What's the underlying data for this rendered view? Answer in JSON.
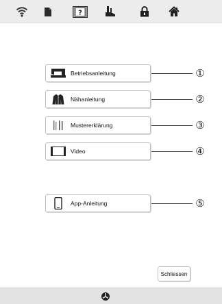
{
  "topbar": {
    "icons": [
      "wifi-icon",
      "page-icon",
      "help-icon",
      "presser-foot-icon",
      "lock-icon",
      "home-icon"
    ]
  },
  "menu": {
    "items": [
      {
        "label": "Betriebsanleitung",
        "icon": "sewing-machine-icon",
        "callout": "①"
      },
      {
        "label": "Nähanleitung",
        "icon": "garment-icon",
        "callout": "②"
      },
      {
        "label": "Mustererklärung",
        "icon": "stitch-pattern-icon",
        "callout": "③"
      },
      {
        "label": "Video",
        "icon": "video-icon",
        "callout": "④"
      },
      {
        "label": "App-Anleitung",
        "icon": "smartphone-icon",
        "callout": "⑤"
      }
    ]
  },
  "footer": {
    "close_label": "Schliessen",
    "bottom_icon": "needle-position-icon"
  },
  "colors": {
    "topbar_bg": "#ececec",
    "bottombar_bg": "#e3e3e3",
    "button_border": "#bdbdbd"
  }
}
